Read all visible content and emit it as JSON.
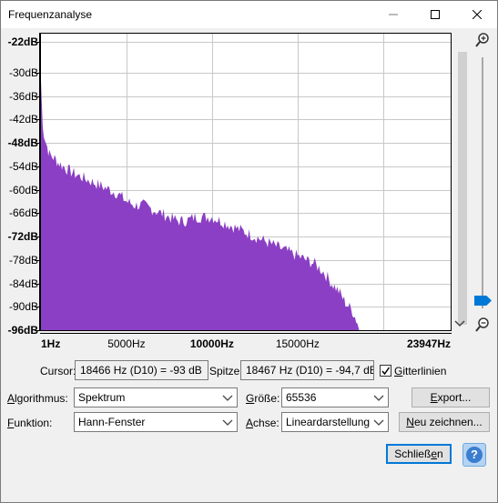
{
  "window": {
    "title": "Frequenzanalyse"
  },
  "chart_data": {
    "type": "area",
    "title": "",
    "xlabel": "",
    "ylabel": "",
    "xlim": [
      1,
      23947
    ],
    "ylim": [
      -96,
      -20
    ],
    "x_tick_labels": [
      "1Hz",
      "5000Hz",
      "10000Hz",
      "15000Hz",
      "23947Hz"
    ],
    "x_tick_values": [
      1,
      5000,
      10000,
      15000,
      23947
    ],
    "y_tick_labels": [
      "-22dB",
      "-30dB",
      "-36dB",
      "-42dB",
      "-48dB",
      "-54dB",
      "-60dB",
      "-66dB",
      "-72dB",
      "-78dB",
      "-84dB",
      "-90dB",
      "-96dB"
    ],
    "y_tick_values": [
      -22,
      -30,
      -36,
      -42,
      -48,
      -54,
      -60,
      -66,
      -72,
      -78,
      -84,
      -90,
      -96
    ],
    "bold_tick_labels": [
      "-22dB",
      "-48dB",
      "-72dB",
      "-96dB",
      "1Hz",
      "10000Hz",
      "23947Hz"
    ],
    "grid": true,
    "fill_color": "#8b3fc4",
    "series": [
      {
        "x": [
          1,
          100,
          300,
          500,
          800,
          1000,
          1300,
          1600,
          2000,
          2500,
          3000,
          3500,
          4000,
          4500,
          5000,
          5500,
          6000,
          6500,
          7000,
          7500,
          8000,
          8500,
          9000,
          9500,
          10000,
          10500,
          11000,
          11500,
          12000,
          12500,
          13000,
          13500,
          14000,
          14500,
          15000,
          15500,
          16000,
          16500,
          17000,
          17400,
          17800,
          18200,
          18500,
          18600
        ],
        "y": [
          -32,
          -44,
          -48,
          -51,
          -52,
          -53,
          -54,
          -55,
          -56,
          -57,
          -58,
          -59,
          -60,
          -61,
          -63,
          -64,
          -64,
          -65,
          -66,
          -67,
          -68,
          -68,
          -67,
          -67,
          -67,
          -68,
          -69,
          -70,
          -71,
          -72,
          -73,
          -74,
          -75,
          -76,
          -77,
          -78,
          -79,
          -81,
          -84,
          -86,
          -89,
          -91,
          -94,
          -96
        ]
      }
    ]
  },
  "cursor": {
    "label": "Cursor:",
    "value": "18466 Hz (D10) = -93 dB"
  },
  "peak": {
    "label": "Spitze:",
    "value": "18467 Hz (D10) = -94,7 dB"
  },
  "grid_checkbox": {
    "label": "Gitterlinien",
    "checked": true
  },
  "algorithm": {
    "label": "Algorithmus:",
    "value": "Spektrum"
  },
  "size": {
    "label": "Größe:",
    "value": "65536"
  },
  "function": {
    "label": "Funktion:",
    "value": "Hann-Fenster"
  },
  "axis": {
    "label": "Achse:",
    "value": "Lineardarstellung"
  },
  "buttons": {
    "export": "Export...",
    "redraw": "Neu zeichnen...",
    "close": "Schließen",
    "help": "?"
  }
}
